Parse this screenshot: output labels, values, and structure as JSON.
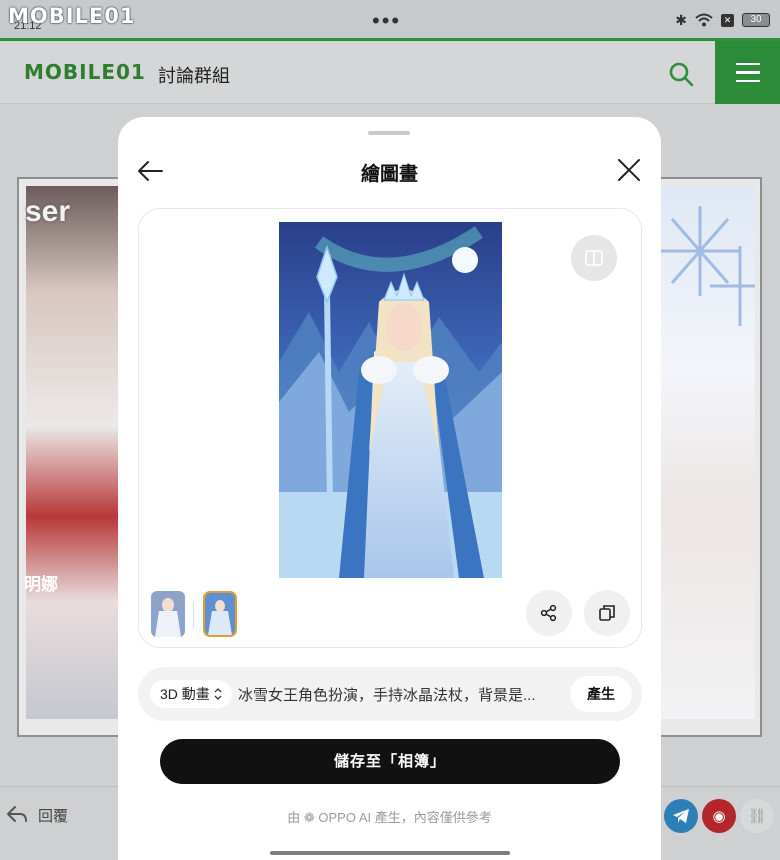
{
  "status_bar": {
    "watermark": "MOBILE01",
    "time": "21:12",
    "more_dots": "•••",
    "battery": "30"
  },
  "site_header": {
    "logo": "MOBILE01",
    "section_title": "討論群組"
  },
  "background_page": {
    "left_image_text": "ser",
    "left_image_cn": "明娜",
    "reply_label": "回覆"
  },
  "modal": {
    "title": "繪圖畫",
    "style_chip": "3D 動畫",
    "prompt_text": "冰雪女王角色扮演，手持冰晶法杖，背景是...",
    "generate_label": "產生",
    "save_label": "儲存至「相簿」",
    "disclaimer": "由 ❁ OPPO AI 產生，內容僅供參考"
  },
  "colors": {
    "brand_green": "#2b8b38",
    "save_button": "#111111",
    "thumb_selected_border": "#e0a030"
  }
}
